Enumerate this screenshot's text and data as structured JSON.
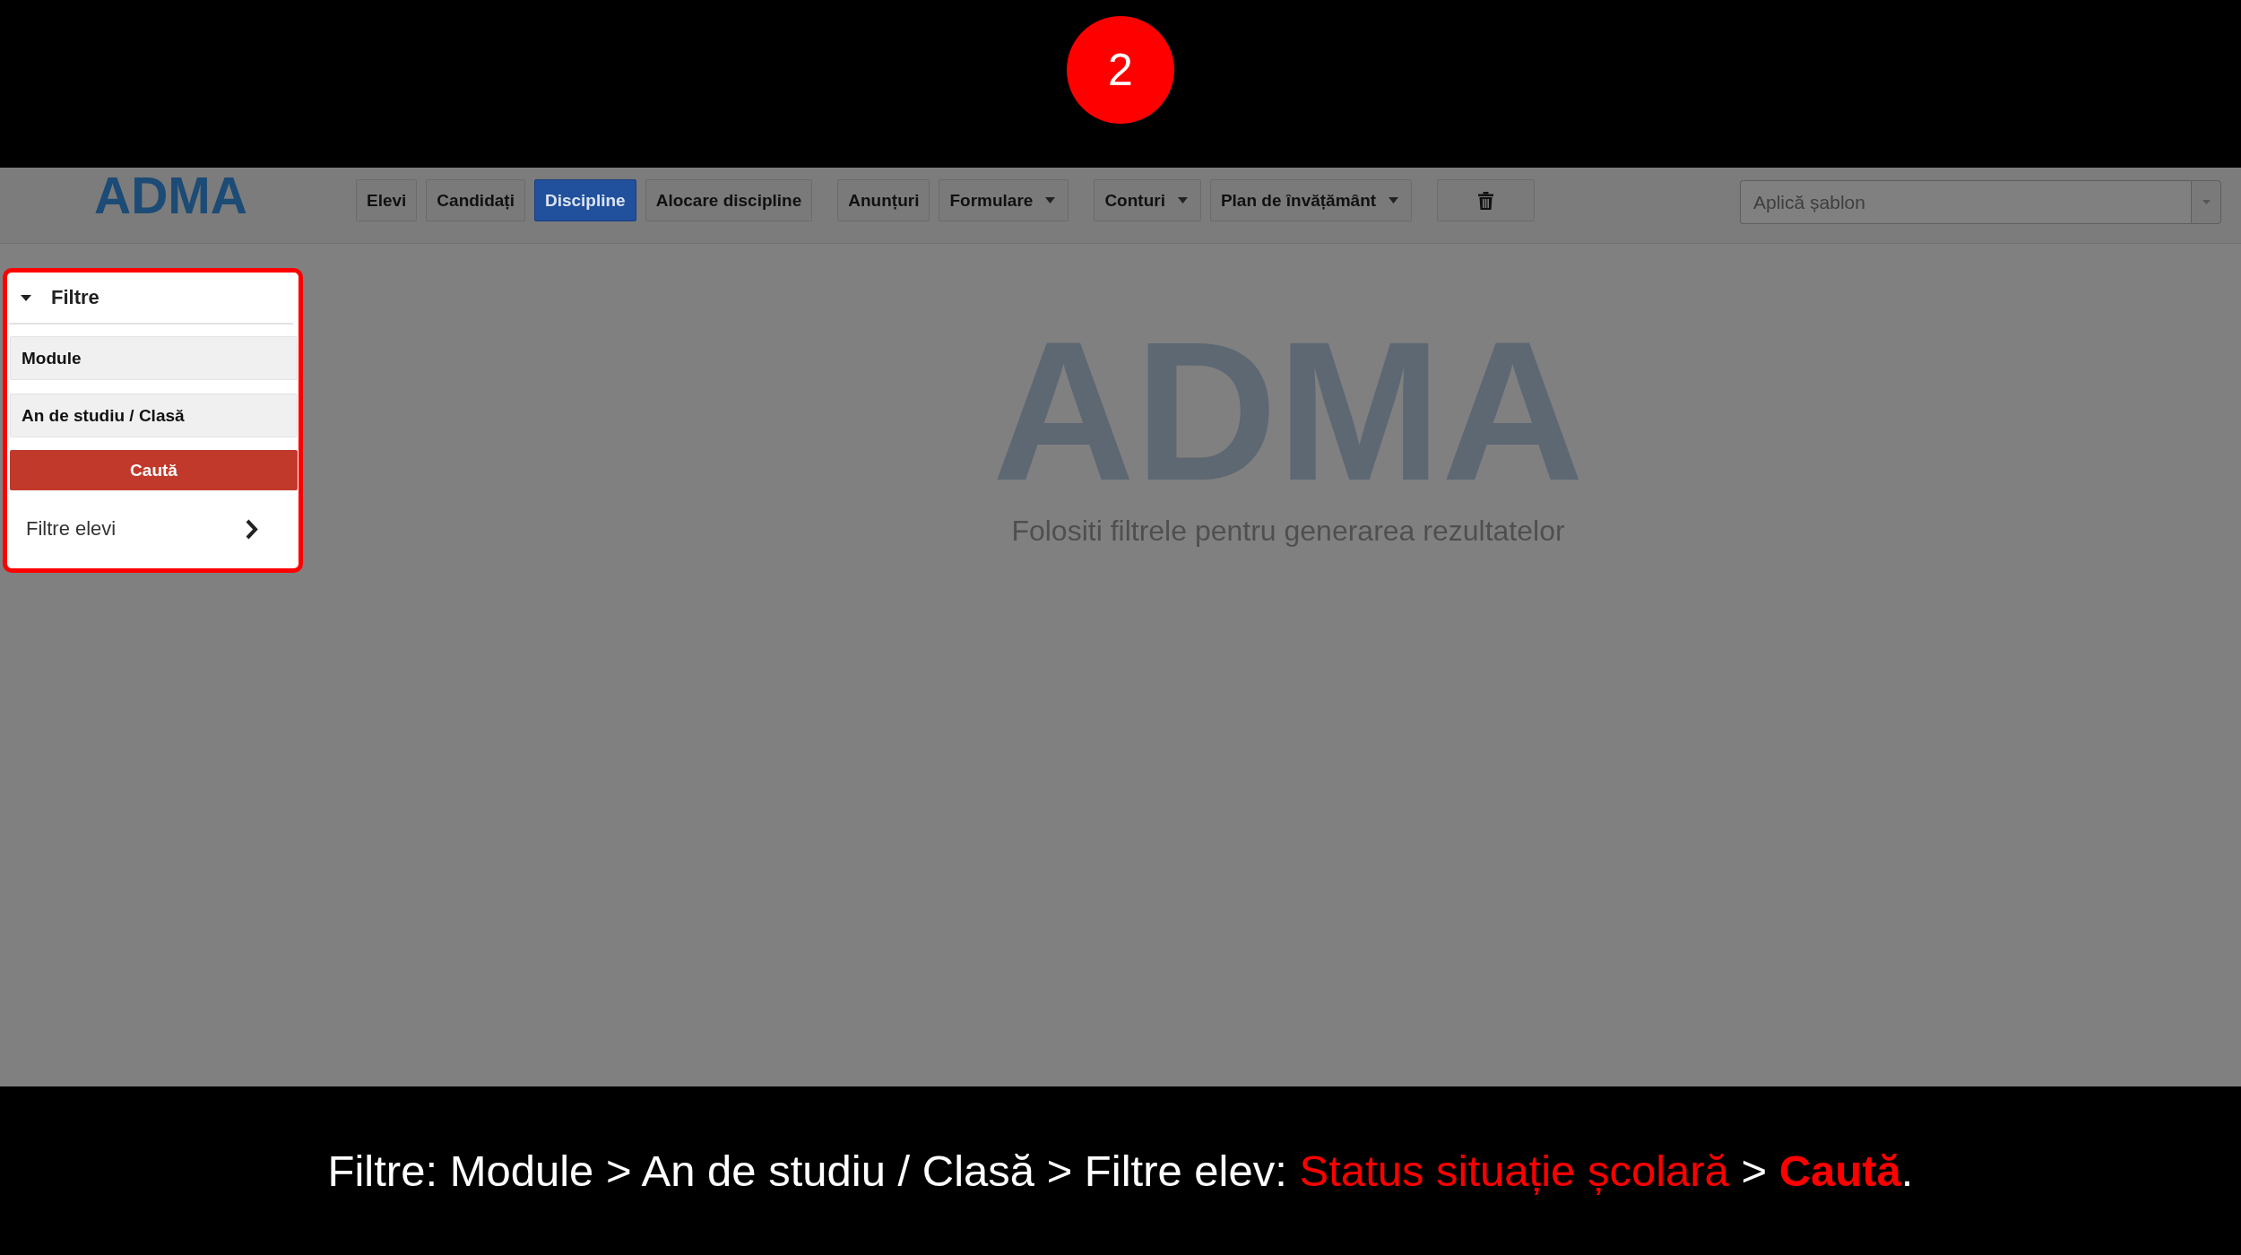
{
  "slide": {
    "step_badge": "2"
  },
  "app": {
    "logo": "ADMA",
    "nav": {
      "groups": [
        {
          "items": [
            {
              "kind": "button",
              "label": "Elevi",
              "selected": false
            },
            {
              "kind": "button",
              "label": "Candidați",
              "selected": false
            },
            {
              "kind": "button",
              "label": "Discipline",
              "selected": true
            },
            {
              "kind": "button",
              "label": "Alocare discipline",
              "selected": false
            }
          ]
        },
        {
          "items": [
            {
              "kind": "button",
              "label": "Anunțuri",
              "selected": false
            },
            {
              "kind": "dropdown",
              "label": "Formulare",
              "selected": false
            }
          ]
        },
        {
          "items": [
            {
              "kind": "dropdown",
              "label": "Conturi",
              "selected": false
            },
            {
              "kind": "dropdown",
              "label": "Plan de învățământ",
              "selected": false
            }
          ]
        },
        {
          "items": [
            {
              "kind": "icon_button",
              "selected": false
            }
          ]
        }
      ]
    },
    "template_select": {
      "placeholder": "Aplică șablon"
    },
    "filters": {
      "highlighted": true,
      "title": "Filtre",
      "expanded": true,
      "sections": [
        {
          "label": "Module"
        },
        {
          "label": "An de studiu / Clasă"
        }
      ],
      "search_button": "Caută",
      "student_filters": {
        "label": "Filtre elevi",
        "expanded": false
      }
    },
    "empty_state": {
      "logo": "ADMA",
      "message": "Folositi filtrele pentru generarea rezultatelor"
    }
  },
  "caption": [
    {
      "kind": "plain",
      "text": "Filtre: Module > An de studiu / Clasă > Filtre elev: "
    },
    {
      "kind": "highlight",
      "text": "Status situație școlară"
    },
    {
      "kind": "plain",
      "text": " > "
    },
    {
      "kind": "highlight_strong",
      "text": "Caută"
    },
    {
      "kind": "plain",
      "text": "."
    }
  ]
}
